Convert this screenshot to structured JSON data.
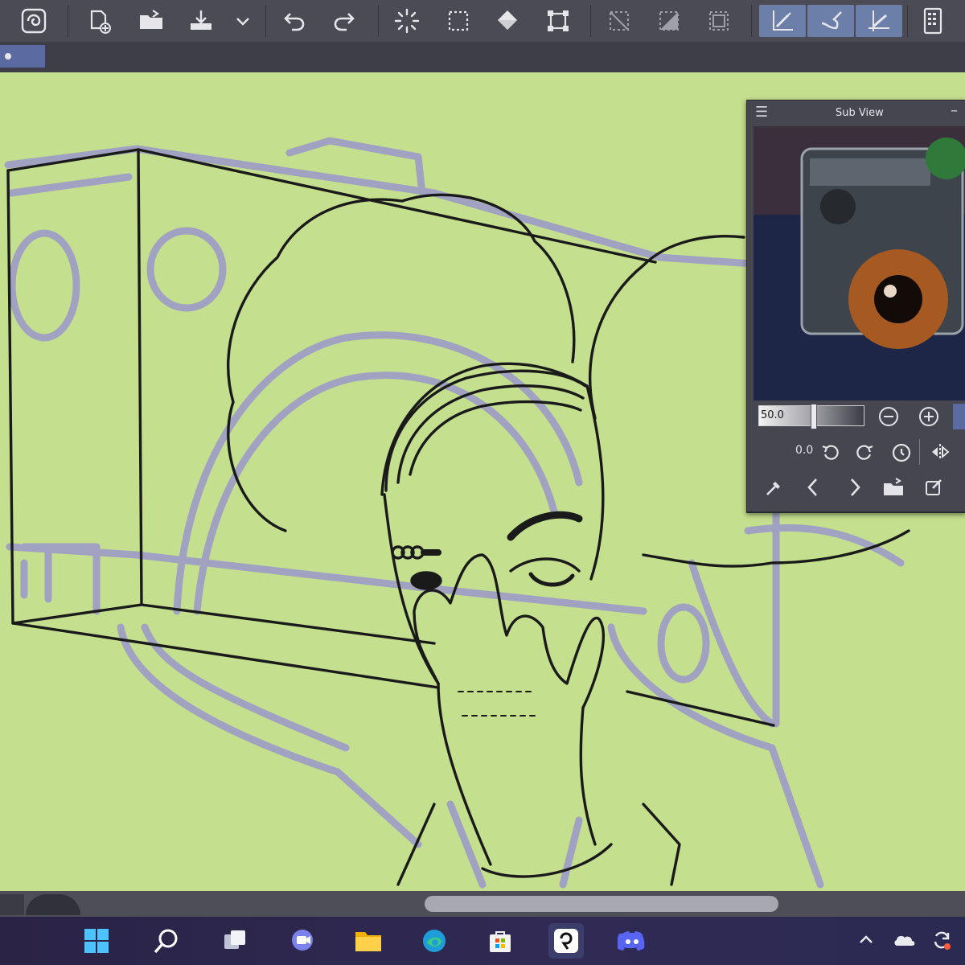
{
  "toolbar": {
    "buttons": [
      {
        "name": "app-logo-icon",
        "icon": "swirl"
      },
      {
        "name": "new-canvas-icon",
        "icon": "new-file"
      },
      {
        "name": "open-file-icon",
        "icon": "folder"
      },
      {
        "name": "save-icon",
        "icon": "save"
      },
      {
        "name": "save-dropdown-icon",
        "icon": "chevron-down"
      },
      {
        "name": "undo-icon",
        "icon": "undo"
      },
      {
        "name": "redo-icon",
        "icon": "redo"
      },
      {
        "name": "loading-icon",
        "icon": "spinner"
      },
      {
        "name": "clear-selection-icon",
        "icon": "selection-dashed"
      },
      {
        "name": "fill-icon",
        "icon": "fill-bucket"
      },
      {
        "name": "transform-icon",
        "icon": "transform"
      },
      {
        "name": "deselect-icon",
        "icon": "deselect"
      },
      {
        "name": "invert-selection-icon",
        "icon": "invert"
      },
      {
        "name": "select-all-icon",
        "icon": "select-all"
      },
      {
        "name": "pen-snap-icon",
        "icon": "pen-snap"
      },
      {
        "name": "brush-snap-icon",
        "icon": "brush-snap"
      },
      {
        "name": "ruler-snap-icon",
        "icon": "ruler-snap"
      },
      {
        "name": "device-icon",
        "icon": "tablet"
      }
    ]
  },
  "subview": {
    "title": "Sub View",
    "zoom_value": "50.0",
    "rotation_value": "0.0",
    "icons": [
      "zoom-out-icon",
      "zoom-in-icon",
      "fit-icon",
      "rotate-left-icon",
      "rotate-right-icon",
      "reset-rotation-icon",
      "flip-icon",
      "eyedropper-icon",
      "prev-icon",
      "next-icon",
      "import-icon",
      "edit-icon"
    ]
  },
  "taskbar": {
    "apps": [
      {
        "name": "windows-start-icon"
      },
      {
        "name": "search-icon"
      },
      {
        "name": "task-view-icon"
      },
      {
        "name": "teams-chat-icon"
      },
      {
        "name": "file-explorer-icon"
      },
      {
        "name": "edge-browser-icon"
      },
      {
        "name": "microsoft-store-icon"
      },
      {
        "name": "clip-studio-icon",
        "active": true
      },
      {
        "name": "discord-icon"
      }
    ],
    "tray": [
      {
        "name": "chevron-up-icon"
      },
      {
        "name": "onedrive-icon"
      },
      {
        "name": "sync-icon"
      }
    ]
  },
  "colors": {
    "canvas_bg": "#c4df8e",
    "toolbar_bg": "#4a4b55",
    "accent_active": "#6b7fa8",
    "sketch": "#9e9cc8",
    "ink": "#1a1a1a"
  }
}
